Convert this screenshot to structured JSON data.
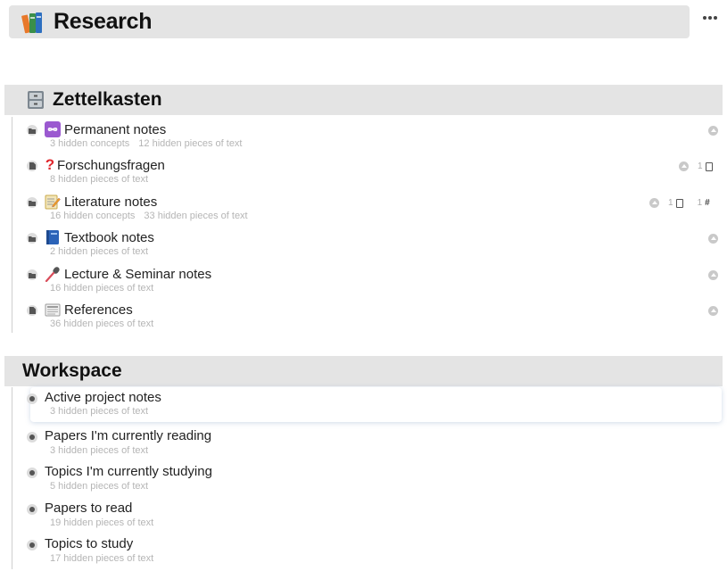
{
  "page": {
    "title": "Research",
    "title_icon": "books-icon",
    "more_icon": "more-horizontal-icon"
  },
  "sections": [
    {
      "title": "Zettelkasten",
      "icon": "file-cabinet-icon",
      "items": [
        {
          "label": "Permanent notes",
          "icon": "infinity-icon",
          "type": "folder",
          "meta": [
            "3 hidden concepts",
            "12 hidden pieces of text"
          ]
        },
        {
          "label": "Forschungsfragen",
          "icon": "question-mark-icon",
          "type": "document",
          "meta": [
            "8 hidden pieces of text"
          ],
          "doc_count": "1"
        },
        {
          "label": "Literature notes",
          "icon": "memo-icon",
          "type": "folder",
          "meta": [
            "16 hidden concepts",
            "33 hidden pieces of text"
          ],
          "doc_count": "1",
          "tag_count": "1"
        },
        {
          "label": "Textbook notes",
          "icon": "blue-book-icon",
          "type": "folder",
          "meta": [
            "2 hidden pieces of text"
          ]
        },
        {
          "label": "Lecture & Seminar notes",
          "icon": "microphone-icon",
          "type": "folder",
          "meta": [
            "16 hidden pieces of text"
          ]
        },
        {
          "label": "References",
          "icon": "newspaper-icon",
          "type": "document",
          "meta": [
            "36 hidden pieces of text"
          ]
        }
      ]
    },
    {
      "title": "Workspace",
      "items": [
        {
          "label": "Active project notes",
          "meta": [
            "3 hidden pieces of text"
          ]
        },
        {
          "label": "Papers I'm currently reading",
          "meta": [
            "3 hidden pieces of text"
          ]
        },
        {
          "label": "Topics I'm currently studying",
          "meta": [
            "5 hidden pieces of text"
          ]
        },
        {
          "label": "Papers to read",
          "meta": [
            "19 hidden pieces of text"
          ]
        },
        {
          "label": "Topics to study",
          "meta": [
            "17 hidden pieces of text"
          ]
        }
      ]
    }
  ],
  "colors": {
    "header_bg": "#e4e4e4",
    "meta_text": "#b5b5b5",
    "infinity_bg": "#9b59d0",
    "question": "#e0282e"
  }
}
